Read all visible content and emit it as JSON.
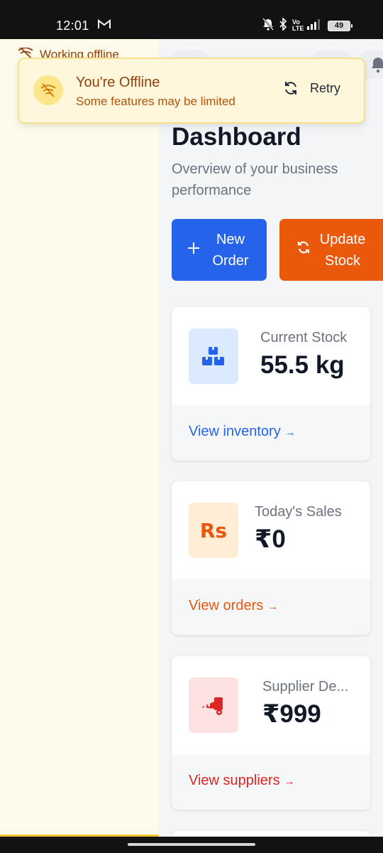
{
  "status_bar": {
    "time": "12:01",
    "battery": "49",
    "network": "Vo LTE"
  },
  "sidebar": {
    "offline_label": "Working offline"
  },
  "toast": {
    "title": "You're Offline",
    "subtitle": "Some features may be limited",
    "retry_label": "Retry"
  },
  "dashboard": {
    "title": "Dashboard",
    "subtitle": "Overview of your business performance",
    "new_order_label": "New Order",
    "update_stock_label": "Update Stock"
  },
  "cards": [
    {
      "label": "Current Stock",
      "value": "55.5 kg",
      "link": "View inventory",
      "arrow": "→",
      "accent": "#2563eb",
      "icon_bg": "#dbeafe"
    },
    {
      "label": "Today's Sales",
      "value": "₹0",
      "link": "View orders",
      "arrow": "→",
      "accent": "#ea580c",
      "icon_bg": "#ffedd5",
      "icon_text": "Rs"
    },
    {
      "label": "Supplier De...",
      "value": "₹999",
      "link": "View suppliers",
      "arrow": "→",
      "accent": "#dc2626",
      "icon_bg": "#fee2e2"
    }
  ]
}
